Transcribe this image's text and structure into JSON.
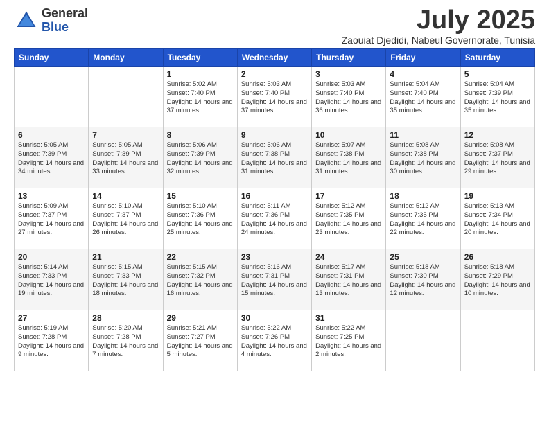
{
  "logo": {
    "general": "General",
    "blue": "Blue"
  },
  "title": "July 2025",
  "subtitle": "Zaouiat Djedidi, Nabeul Governorate, Tunisia",
  "headers": [
    "Sunday",
    "Monday",
    "Tuesday",
    "Wednesday",
    "Thursday",
    "Friday",
    "Saturday"
  ],
  "weeks": [
    [
      {
        "day": "",
        "info": ""
      },
      {
        "day": "",
        "info": ""
      },
      {
        "day": "1",
        "info": "Sunrise: 5:02 AM\nSunset: 7:40 PM\nDaylight: 14 hours and 37 minutes."
      },
      {
        "day": "2",
        "info": "Sunrise: 5:03 AM\nSunset: 7:40 PM\nDaylight: 14 hours and 37 minutes."
      },
      {
        "day": "3",
        "info": "Sunrise: 5:03 AM\nSunset: 7:40 PM\nDaylight: 14 hours and 36 minutes."
      },
      {
        "day": "4",
        "info": "Sunrise: 5:04 AM\nSunset: 7:40 PM\nDaylight: 14 hours and 35 minutes."
      },
      {
        "day": "5",
        "info": "Sunrise: 5:04 AM\nSunset: 7:39 PM\nDaylight: 14 hours and 35 minutes."
      }
    ],
    [
      {
        "day": "6",
        "info": "Sunrise: 5:05 AM\nSunset: 7:39 PM\nDaylight: 14 hours and 34 minutes."
      },
      {
        "day": "7",
        "info": "Sunrise: 5:05 AM\nSunset: 7:39 PM\nDaylight: 14 hours and 33 minutes."
      },
      {
        "day": "8",
        "info": "Sunrise: 5:06 AM\nSunset: 7:39 PM\nDaylight: 14 hours and 32 minutes."
      },
      {
        "day": "9",
        "info": "Sunrise: 5:06 AM\nSunset: 7:38 PM\nDaylight: 14 hours and 31 minutes."
      },
      {
        "day": "10",
        "info": "Sunrise: 5:07 AM\nSunset: 7:38 PM\nDaylight: 14 hours and 31 minutes."
      },
      {
        "day": "11",
        "info": "Sunrise: 5:08 AM\nSunset: 7:38 PM\nDaylight: 14 hours and 30 minutes."
      },
      {
        "day": "12",
        "info": "Sunrise: 5:08 AM\nSunset: 7:37 PM\nDaylight: 14 hours and 29 minutes."
      }
    ],
    [
      {
        "day": "13",
        "info": "Sunrise: 5:09 AM\nSunset: 7:37 PM\nDaylight: 14 hours and 27 minutes."
      },
      {
        "day": "14",
        "info": "Sunrise: 5:10 AM\nSunset: 7:37 PM\nDaylight: 14 hours and 26 minutes."
      },
      {
        "day": "15",
        "info": "Sunrise: 5:10 AM\nSunset: 7:36 PM\nDaylight: 14 hours and 25 minutes."
      },
      {
        "day": "16",
        "info": "Sunrise: 5:11 AM\nSunset: 7:36 PM\nDaylight: 14 hours and 24 minutes."
      },
      {
        "day": "17",
        "info": "Sunrise: 5:12 AM\nSunset: 7:35 PM\nDaylight: 14 hours and 23 minutes."
      },
      {
        "day": "18",
        "info": "Sunrise: 5:12 AM\nSunset: 7:35 PM\nDaylight: 14 hours and 22 minutes."
      },
      {
        "day": "19",
        "info": "Sunrise: 5:13 AM\nSunset: 7:34 PM\nDaylight: 14 hours and 20 minutes."
      }
    ],
    [
      {
        "day": "20",
        "info": "Sunrise: 5:14 AM\nSunset: 7:33 PM\nDaylight: 14 hours and 19 minutes."
      },
      {
        "day": "21",
        "info": "Sunrise: 5:15 AM\nSunset: 7:33 PM\nDaylight: 14 hours and 18 minutes."
      },
      {
        "day": "22",
        "info": "Sunrise: 5:15 AM\nSunset: 7:32 PM\nDaylight: 14 hours and 16 minutes."
      },
      {
        "day": "23",
        "info": "Sunrise: 5:16 AM\nSunset: 7:31 PM\nDaylight: 14 hours and 15 minutes."
      },
      {
        "day": "24",
        "info": "Sunrise: 5:17 AM\nSunset: 7:31 PM\nDaylight: 14 hours and 13 minutes."
      },
      {
        "day": "25",
        "info": "Sunrise: 5:18 AM\nSunset: 7:30 PM\nDaylight: 14 hours and 12 minutes."
      },
      {
        "day": "26",
        "info": "Sunrise: 5:18 AM\nSunset: 7:29 PM\nDaylight: 14 hours and 10 minutes."
      }
    ],
    [
      {
        "day": "27",
        "info": "Sunrise: 5:19 AM\nSunset: 7:28 PM\nDaylight: 14 hours and 9 minutes."
      },
      {
        "day": "28",
        "info": "Sunrise: 5:20 AM\nSunset: 7:28 PM\nDaylight: 14 hours and 7 minutes."
      },
      {
        "day": "29",
        "info": "Sunrise: 5:21 AM\nSunset: 7:27 PM\nDaylight: 14 hours and 5 minutes."
      },
      {
        "day": "30",
        "info": "Sunrise: 5:22 AM\nSunset: 7:26 PM\nDaylight: 14 hours and 4 minutes."
      },
      {
        "day": "31",
        "info": "Sunrise: 5:22 AM\nSunset: 7:25 PM\nDaylight: 14 hours and 2 minutes."
      },
      {
        "day": "",
        "info": ""
      },
      {
        "day": "",
        "info": ""
      }
    ]
  ]
}
